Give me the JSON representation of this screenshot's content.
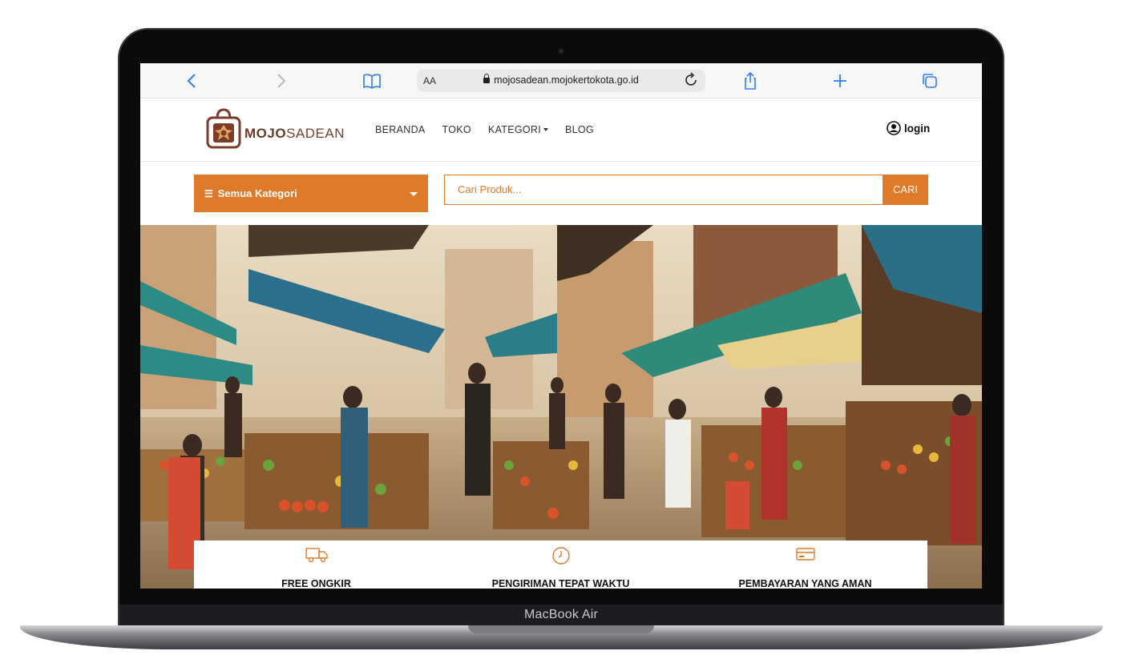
{
  "device": {
    "label": "MacBook Air"
  },
  "browser": {
    "reader_label": "AA",
    "url": "mojosadean.mojokertokota.go.id",
    "buttons": [
      "back-icon",
      "forward-icon",
      "bookmarks-icon",
      "reload-icon",
      "share-icon",
      "new-tab-icon",
      "tabs-icon"
    ]
  },
  "site": {
    "logo": {
      "part1": "MOJO",
      "part2": "SADEAN"
    },
    "nav": [
      {
        "label": "BERANDA"
      },
      {
        "label": "TOKO"
      },
      {
        "label": "KATEGORI"
      },
      {
        "label": "BLOG"
      }
    ],
    "login_label": "login",
    "category_select": "Semua Kategori",
    "search_placeholder": "Cari Produk...",
    "search_button": "CARI",
    "features": [
      {
        "icon": "truck-icon",
        "label": "FREE ONGKIR"
      },
      {
        "icon": "clock-icon",
        "label": "PENGIRIMAN TEPAT WAKTU"
      },
      {
        "icon": "credit-card-icon",
        "label": "PEMBAYARAN YANG AMAN"
      }
    ]
  },
  "colors": {
    "accent": "#e07a2b",
    "brand": "#6b3a2a",
    "browser_blue": "#2f7df6"
  }
}
